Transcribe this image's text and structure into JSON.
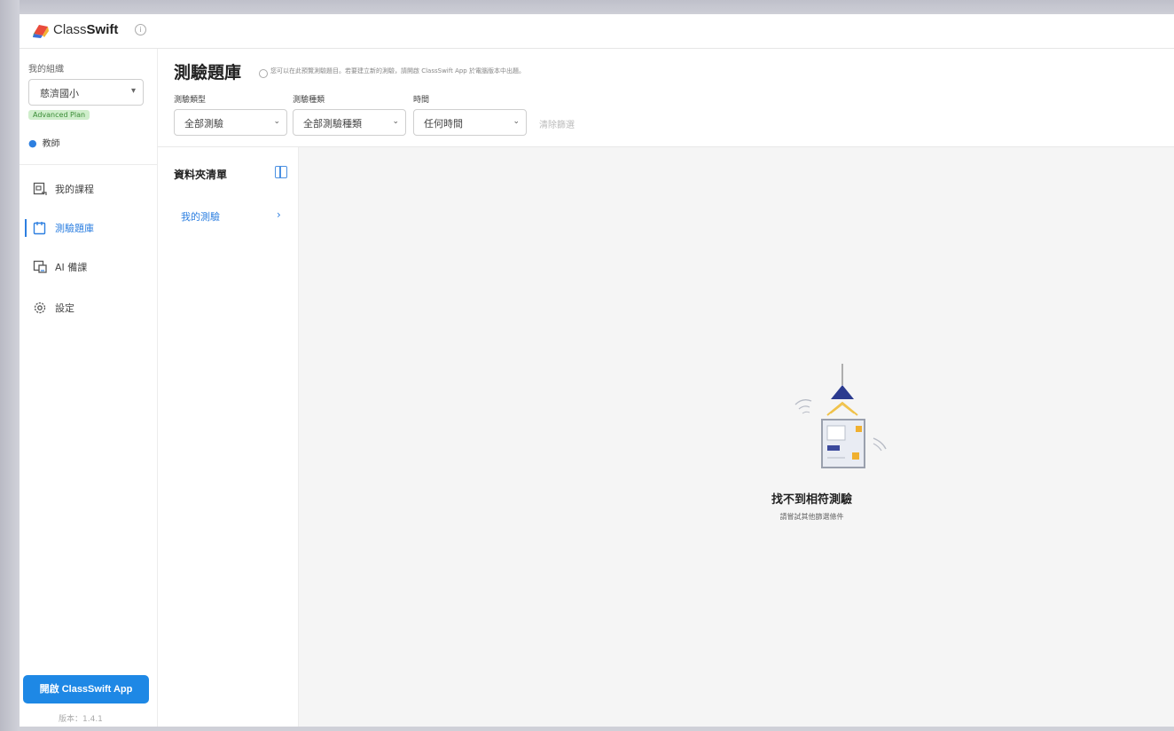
{
  "app": {
    "name_light": "Class",
    "name_bold": "Swift",
    "help_icon": "info-circle-icon"
  },
  "sidebar": {
    "org_label": "我的組織",
    "org_value": "慈濟國小",
    "plan_badge": "Advanced Plan",
    "user_role": "教師",
    "items": [
      {
        "label": "我的課程",
        "icon": "class-board-icon"
      },
      {
        "label": "測驗題庫",
        "icon": "quiz-bank-icon",
        "active": true
      },
      {
        "label": "AI 備課",
        "icon": "ai-prep-icon"
      },
      {
        "label": "設定",
        "icon": "gear-icon"
      }
    ],
    "open_app_label": "開啟 ClassSwift App",
    "version": "版本：1.4.1"
  },
  "header": {
    "title": "測驗題庫",
    "hint": "您可以在此預覽測驗題目。若要建立新的測驗，請開啟 ClassSwift App 於電腦版本中出題。",
    "filters": [
      {
        "label": "測驗類型",
        "value": "全部測驗"
      },
      {
        "label": "測驗種類",
        "value": "全部測驗種類"
      },
      {
        "label": "時間",
        "value": "任何時間"
      }
    ],
    "reset_label": "清除篩選"
  },
  "folder_panel": {
    "title": "資料夾清單",
    "items": [
      {
        "label": "我的測驗"
      }
    ]
  },
  "empty_state": {
    "title": "找不到相符測驗",
    "subtitle": "請嘗試其他篩選條件"
  },
  "colors": {
    "accent": "#2d7fe0",
    "button": "#1e88e5",
    "main_bg": "#f5f5f5"
  }
}
